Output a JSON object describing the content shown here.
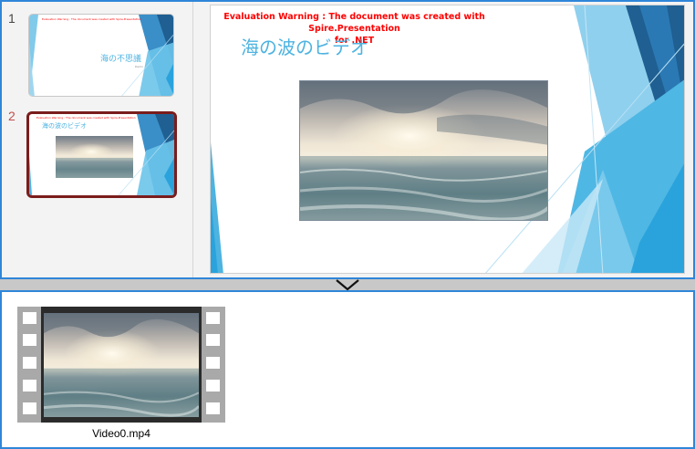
{
  "slides_panel": {
    "slides": [
      {
        "number": "1",
        "title": "海の不思議",
        "subtitle": "Demo"
      },
      {
        "number": "2",
        "title": "海の波のビデオ",
        "selected": true
      }
    ]
  },
  "current_slide": {
    "warning_line1": "Evaluation Warning : The document was created with  Spire.Presentation",
    "warning_line2": "for .NET",
    "title": "海の波のビデオ",
    "media": "ocean-waves-video-frame"
  },
  "file_browser": {
    "items": [
      {
        "name": "Video0.mp4",
        "icon": "video-file-icon"
      }
    ]
  },
  "colors": {
    "accent_blue": "#2f86d8",
    "title_blue": "#4db3e0",
    "warning_red": "#ff0000",
    "selected_border": "#7b1c1c",
    "selected_number": "#c0504d"
  }
}
